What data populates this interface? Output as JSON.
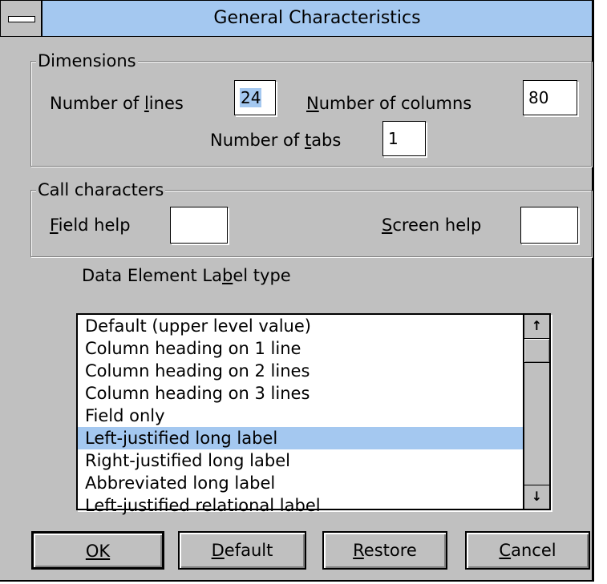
{
  "window": {
    "title": "General Characteristics",
    "system_menu_icon": "system-menu-icon"
  },
  "dimensions": {
    "group_label": "Dimensions",
    "lines_label": "Number of lines",
    "lines_mnemonic": "l",
    "lines_value": "24",
    "columns_label": "Number of columns",
    "columns_mnemonic": "N",
    "columns_value": "80",
    "tabs_label": "Number of tabs",
    "tabs_mnemonic": "t",
    "tabs_value": "1"
  },
  "call_characters": {
    "group_label": "Call characters",
    "field_help_label": "Field help",
    "field_help_value": "",
    "screen_help_label": "Screen help",
    "screen_help_value": ""
  },
  "label_type": {
    "heading": "Data Element Label type",
    "items": [
      "Default (upper level value)",
      "Column heading on 1 line",
      "Column heading on 2 lines",
      "Column heading on 3 lines",
      "Field only",
      "Left-justified long label",
      "Right-justified long label",
      "Abbreviated long label",
      "Left-justified relational label"
    ],
    "selected_index": 5,
    "scroll_up_icon": "arrow-up-icon",
    "scroll_down_icon": "arrow-down-icon"
  },
  "buttons": {
    "ok": "OK",
    "default": "Default",
    "restore": "Restore",
    "cancel": "Cancel"
  },
  "colors": {
    "dialog_bg": "#c0c0c0",
    "highlight": "#a4c8f0"
  }
}
